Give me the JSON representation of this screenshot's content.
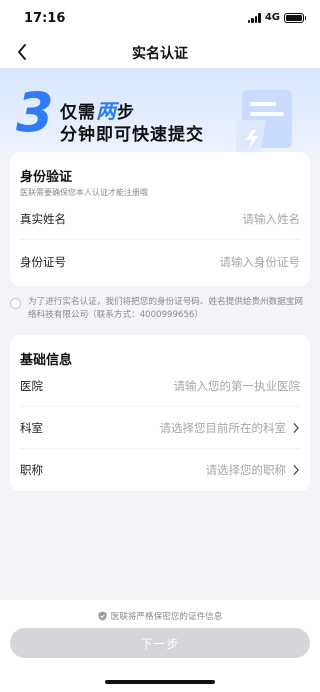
{
  "status_bar": {
    "time": "17:16",
    "network": "4G"
  },
  "navbar": {
    "title": "实名认证"
  },
  "hero": {
    "number": "3",
    "line1_pre": "仅需",
    "line1_highlight": "两",
    "line1_post": "步",
    "line2": "分钟即可快速提交"
  },
  "identity": {
    "title": "身份验证",
    "subtitle": "医联需要确保您本人认证才能注册哦",
    "fields": [
      {
        "label": "真实姓名",
        "placeholder": "请输入姓名"
      },
      {
        "label": "身份证号",
        "placeholder": "请输入身份证号"
      }
    ]
  },
  "consent": {
    "text": "为了进行实名认证，我们将把您的身份证号码、姓名提供给贵州数据宝网络科技有限公司（联系方式：4000999656）"
  },
  "basic": {
    "title": "基础信息",
    "fields": [
      {
        "label": "医院",
        "placeholder": "请输入您的第一执业医院"
      },
      {
        "label": "科室",
        "placeholder": "请选择您目前所在的科室"
      },
      {
        "label": "职称",
        "placeholder": "请选择您的职称"
      }
    ]
  },
  "footer": {
    "secure_text": "医联将严格保密您的证件信息",
    "next_label": "下一步"
  },
  "icons": {
    "back": "back-arrow-icon",
    "chevron": "chevron-right-icon",
    "shield": "shield-icon"
  },
  "colors": {
    "accent": "#2f7bf5",
    "button_disabled": "#d6d6da"
  }
}
